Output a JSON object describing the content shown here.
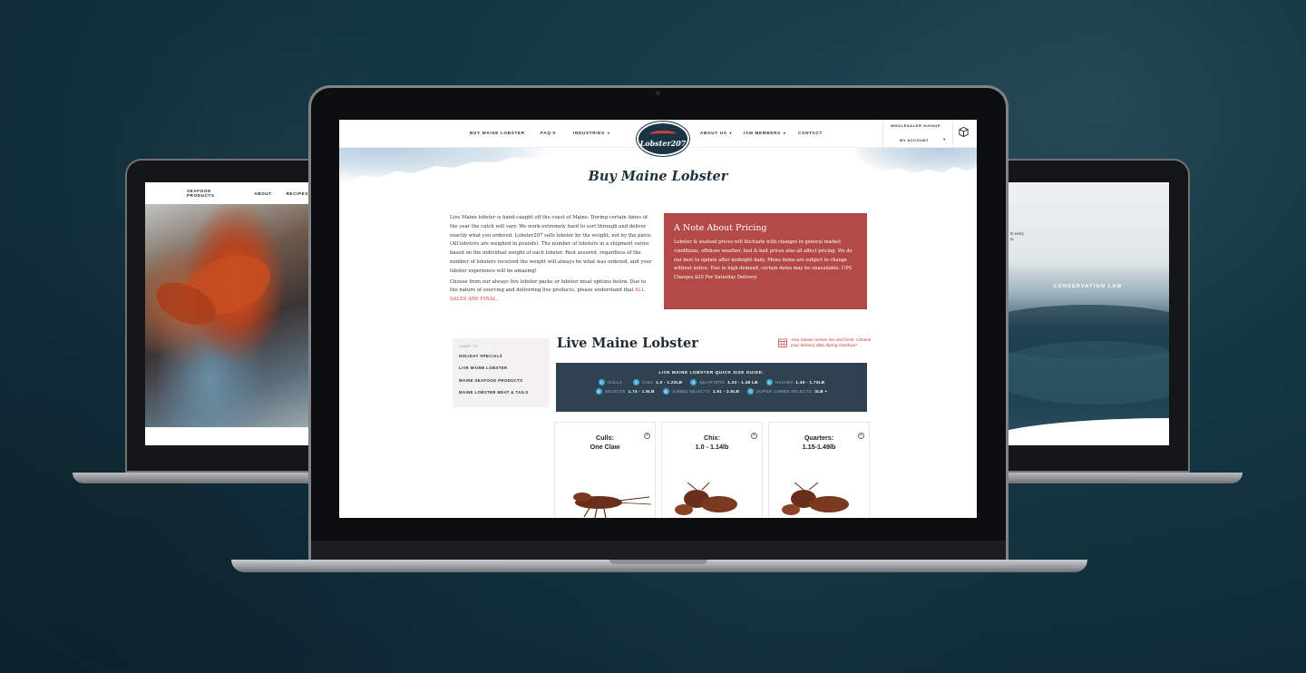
{
  "left_site": {
    "nav": [
      "SEAFOOD PRODUCTS",
      "ABOUT",
      "RECIPES"
    ]
  },
  "right_site": {
    "hero_text": "CONSERVATION LAW",
    "snippet": [
      "th every",
      "to"
    ]
  },
  "header": {
    "nav_left": [
      "BUY MAINE LOBSTER",
      "FAQ'S",
      "INDUSTRIES"
    ],
    "nav_right": [
      "ABOUT US",
      "IAM MEMBERS",
      "CONTACT"
    ],
    "logo_text": "Lobster207",
    "wholesale": "WHOLESALER SIGNUP",
    "account": "MY ACCOUNT"
  },
  "page": {
    "title": "Buy Maine Lobster",
    "intro_p1": "Live Maine lobster is hand-caught off the coast of Maine. During certain times of the year the catch will vary. We work extremely hard to sort through and deliver exactly what you ordered. Lobster207 sells lobster by the weight, not by the piece. (All lobsters are weighed in pounds). The number of lobsters in a shipment varies based on the individual weight of each lobster. Rest assured, regardless of the number of lobsters received the weight will always be what was ordered, and your lobster experience will be amazing!",
    "intro_p2": "Choose from our always live lobster packs or lobster meat options below. Due to the nature of sourcing and delivering live products, please understand that ",
    "intro_final": "ALL SALES ARE FINAL.",
    "note_title": "A Note About Pricing",
    "note_body": "Lobster & seafood prices will fluctuate with changes in general market conditions, offshore weather, fuel & bait prices also all affect pricing. We do our best to update after midnight daily. Menu items are subject to change without notice. Due to high demand, certain dates may be unavailable. UPS Charges $20 For Saturday Delivery."
  },
  "jump": {
    "label": "JUMP TO:",
    "links": [
      "HOLIDAY SPECIALS",
      "LIVE MAINE LOBSTER",
      "MAINE SEAFOOD PRODUCTS",
      "MAINE LOBSTER MEAT & TAILS"
    ]
  },
  "section": {
    "title": "Live Maine Lobster",
    "delivery_note": "Your lobster arrives live and fresh. Choose your delivery date during checkout*"
  },
  "guide": {
    "title": "LIVE MAINE LOBSTER QUICK SIZE GUIDE:",
    "row1": [
      {
        "n": "1",
        "name": "CULLS",
        "range": ""
      },
      {
        "n": "2",
        "name": "CHIX",
        "range": "1.0 - 1.23LB"
      },
      {
        "n": "3",
        "name": "QUARTERS",
        "range": "1.24 - 1.48 LB"
      },
      {
        "n": "4",
        "name": "HALVES",
        "range": "1.49 - 1.73LB"
      }
    ],
    "row2": [
      {
        "n": "5",
        "name": "SELECTS",
        "range": "1.74 - 1.9LB"
      },
      {
        "n": "6",
        "name": "JUMBO SELECTS",
        "range": "1.91 - 2.5LB"
      },
      {
        "n": "7",
        "name": "SUPER JUMBO SELECTS",
        "range": "3LB +"
      }
    ]
  },
  "products": [
    {
      "line1": "Culls:",
      "line2": "One Claw"
    },
    {
      "line1": "Chix:",
      "line2": "1.0 - 1.14lb"
    },
    {
      "line1": "Quarters:",
      "line2": "1.15-1.49lb"
    }
  ],
  "colors": {
    "background": "#143643",
    "navy": "#1f3240",
    "note_red": "#b34a48",
    "guide_bg": "#2f4250",
    "accent_blue": "#4aa7d8",
    "alert_red": "#d93a36"
  }
}
